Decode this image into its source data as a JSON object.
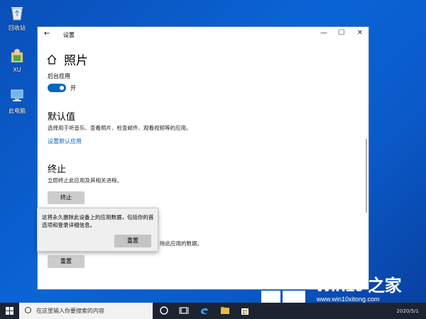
{
  "desktop": {
    "icons": [
      {
        "label": "回收站"
      },
      {
        "label": "XU"
      },
      {
        "label": "此电脑"
      }
    ]
  },
  "window": {
    "title": "设置",
    "page_title": "照片",
    "background_apps_label": "后台应用",
    "toggle_state": "开",
    "defaults": {
      "title": "默认值",
      "description": "选择用于听音乐、查看照片、检查邮件、观看视频等的应用。",
      "link": "设置默认应用"
    },
    "terminate": {
      "title": "终止",
      "description": "立即终止此应用及其相关进程。",
      "button": "终止"
    },
    "reset": {
      "partial_description": "除此应用的数据。",
      "button": "重置"
    }
  },
  "flyout": {
    "message": "这将永久删除此设备上的应用数据，包括你的首选项和登录详细信息。",
    "button": "重置"
  },
  "taskbar": {
    "search_placeholder": "在这里输入你要搜索的内容",
    "clock": "2020/5/1"
  },
  "watermark": {
    "title": "Win10 之家",
    "url": "www.win10xitong.com"
  },
  "colors": {
    "accent": "#0067c0",
    "desktop": "#0b64d6",
    "taskbar": "#1c2430"
  }
}
